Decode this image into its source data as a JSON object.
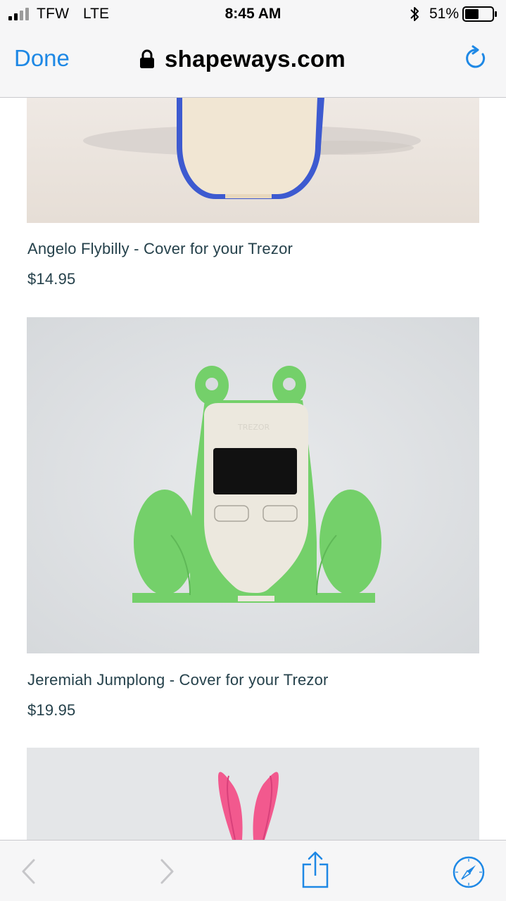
{
  "status_bar": {
    "carrier": "TFW",
    "network": "LTE",
    "time": "8:45 AM",
    "battery_percent": "51%",
    "battery_level": 0.51
  },
  "browser": {
    "done_label": "Done",
    "url": "shapeways.com"
  },
  "products": [
    {
      "name": "Angelo Flybilly - Cover for your Trezor",
      "price": "$14.95"
    },
    {
      "name": "Jeremiah Jumplong - Cover for your Trezor",
      "price": "$19.95"
    }
  ],
  "toolbar": {
    "icons": [
      "back-icon",
      "forward-icon",
      "share-icon",
      "compass-icon"
    ]
  },
  "colors": {
    "accent": "#1e88e5",
    "text": "#25414b",
    "frog_green": "#74d06a",
    "bunny_pink": "#f2598e",
    "penguin_blue": "#3d5ad0"
  }
}
